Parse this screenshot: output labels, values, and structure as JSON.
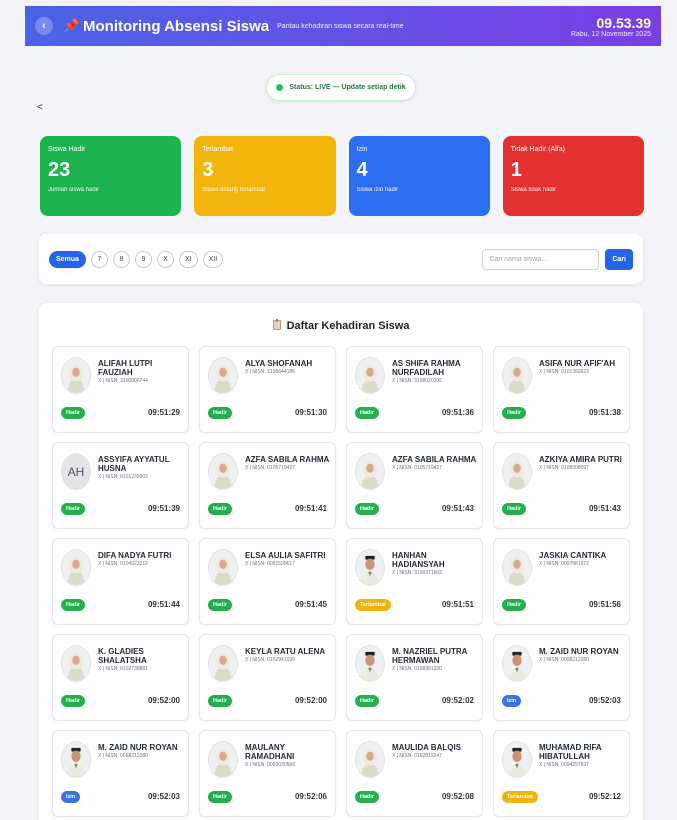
{
  "header": {
    "back_glyph": "‹",
    "pin_glyph": "📌",
    "title": "Monitoring Absensi Siswa",
    "subtitle": "Pantau kehadiran siswa secara real-time",
    "time": "09.53.39",
    "date": "Rabu, 12 November 2025"
  },
  "live_status": "Status: LIVE — Update setiap detik",
  "small_back": "<",
  "stats": [
    {
      "label": "Siswa Hadir",
      "value": "23",
      "desc": "Jumlah siswa hadir",
      "color": "#1db34f"
    },
    {
      "label": "Terlambat",
      "value": "3",
      "desc": "Siswa datang terlambat",
      "color": "#f1b50c"
    },
    {
      "label": "Izin",
      "value": "4",
      "desc": "Siswa izin hadir",
      "color": "#2c6ef0"
    },
    {
      "label": "Tidak Hadir (Alfa)",
      "value": "1",
      "desc": "Siswa tidak hadir",
      "color": "#e53030"
    }
  ],
  "filter": {
    "chips": [
      "Semua",
      "7",
      "8",
      "9",
      "X",
      "XI",
      "XII"
    ],
    "search_placeholder": "Cari nama siswa...",
    "search_button": "Cari"
  },
  "list": {
    "title": "Daftar Kehadiran Siswa",
    "students": [
      {
        "name": "ALIFAH LUTPI FAUZIAH",
        "nisn": "X | NISN: 3100806744",
        "status": "Hadir",
        "time": "09:51:29",
        "avatar": "female",
        "initials": ""
      },
      {
        "name": "ALYA SHOFANAH",
        "nisn": "X | NISN: 3105644186",
        "status": "Hadir",
        "time": "09:51:30",
        "avatar": "female",
        "initials": ""
      },
      {
        "name": "AS SHIFA RAHMA NURFADILAH",
        "nisn": "X | NISN: 3108020206",
        "status": "Hadir",
        "time": "09:51:36",
        "avatar": "female",
        "initials": ""
      },
      {
        "name": "ASIFA NUR AFIF'AH",
        "nisn": "X | NISN: 0101392923",
        "status": "Hadir",
        "time": "09:51:38",
        "avatar": "female",
        "initials": ""
      },
      {
        "name": "ASSYIFA AYYATUL HUSNA",
        "nisn": "X | NISN: 0101239902",
        "status": "Hadir",
        "time": "09:51:39",
        "avatar": "initials",
        "initials": "AH"
      },
      {
        "name": "AZFA SABILA RAHMA",
        "nisn": "X | NISN: 0105719427",
        "status": "Hadir",
        "time": "09:51:41",
        "avatar": "female",
        "initials": ""
      },
      {
        "name": "AZFA SABILA RAHMA",
        "nisn": "X | NISN: 0105719427",
        "status": "Hadir",
        "time": "09:51:43",
        "avatar": "female",
        "initials": ""
      },
      {
        "name": "AZKIYA AMIRA PUTRI",
        "nisn": "X | NISN: 0108308097",
        "status": "Hadir",
        "time": "09:51:43",
        "avatar": "female",
        "initials": ""
      },
      {
        "name": "DIFA NADYA FUTRI",
        "nisn": "X | NISN: 0104923212",
        "status": "Hadir",
        "time": "09:51:44",
        "avatar": "female",
        "initials": ""
      },
      {
        "name": "ELSA AULIA SAFITRI",
        "nisn": "X | NISN: 0091539617",
        "status": "Hadir",
        "time": "09:51:45",
        "avatar": "female",
        "initials": ""
      },
      {
        "name": "HANHAN HADIANSYAH",
        "nisn": "X | NISN: 3100371503",
        "status": "Terlambat",
        "time": "09:51:51",
        "avatar": "male",
        "initials": ""
      },
      {
        "name": "JASKIA CANTIKA",
        "nisn": "X | NISN: 0097981972",
        "status": "Hadir",
        "time": "09:51:56",
        "avatar": "female",
        "initials": ""
      },
      {
        "name": "K. GLADIES SHALATSHA",
        "nisn": "X | NISN: 0102738881",
        "status": "Hadir",
        "time": "09:52:00",
        "avatar": "female",
        "initials": ""
      },
      {
        "name": "KEYLA RATU ALENA",
        "nisn": "X | NISN: 0102941030",
        "status": "Hadir",
        "time": "09:52:00",
        "avatar": "female",
        "initials": ""
      },
      {
        "name": "M. NAZRIEL PUTRA HERMAWAN",
        "nisn": "X | NISN: 0108381320",
        "status": "Hadir",
        "time": "09:52:02",
        "avatar": "male",
        "initials": ""
      },
      {
        "name": "M. ZAID NUR ROYAN",
        "nisn": "X | NISN: 0098212280",
        "status": "Izin",
        "time": "09:52:03",
        "avatar": "male",
        "initials": ""
      },
      {
        "name": "M. ZAID NUR ROYAN",
        "nisn": "X | NISN: 0098212280",
        "status": "Izin",
        "time": "09:52:03",
        "avatar": "male",
        "initials": ""
      },
      {
        "name": "MAULANY RAMADHANI",
        "nisn": "X | NISN: 0093030568",
        "status": "Hadir",
        "time": "09:52:06",
        "avatar": "female",
        "initials": ""
      },
      {
        "name": "MAULIDA BALQIS",
        "nisn": "X | NISN: 0102819247",
        "status": "Hadir",
        "time": "09:52:08",
        "avatar": "female",
        "initials": ""
      },
      {
        "name": "MUHAMAD RIFA HIBATULLAH",
        "nisn": "X | NISN: 0094297837",
        "status": "Terlambat",
        "time": "09:52:12",
        "avatar": "male",
        "initials": ""
      }
    ]
  },
  "status_colors": {
    "Hadir": "#22b14c",
    "Terlambat": "#efb20f",
    "Izin": "#3a73e8",
    "Alfa": "#e53030"
  }
}
